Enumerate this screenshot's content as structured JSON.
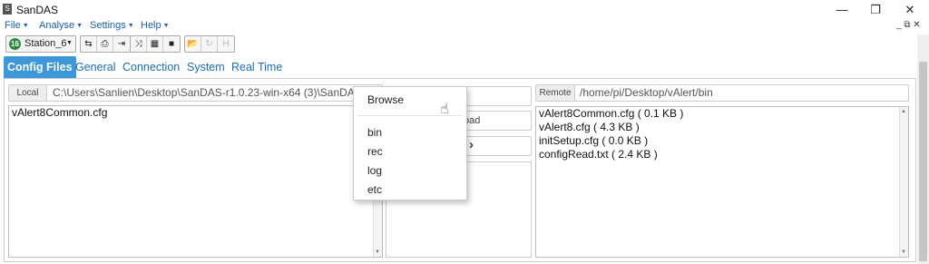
{
  "window": {
    "app_icon": "S",
    "title": "SanDAS",
    "minimize": "—",
    "restore": "❐",
    "close": "✕"
  },
  "menu": {
    "items": [
      "File",
      "Analyse",
      "Settings",
      "Help"
    ],
    "mdi_controls": "_ ⧉ ✕"
  },
  "toolbar": {
    "station_badge": "16",
    "station_label": "Station_6",
    "group1": [
      "⇆",
      "⎙",
      "⇥"
    ],
    "group2": [
      "⤨",
      "▦",
      "■"
    ],
    "group3": [
      "📂",
      "↻",
      "H"
    ]
  },
  "tabs": [
    "Config Files",
    "General",
    "Connection",
    "System",
    "Real Time"
  ],
  "local": {
    "tag": "Local",
    "path": "C:\\Users\\Sanlien\\Desktop\\SanDAS-r1.0.23-win-x64 (3)\\SanDASD",
    "files": [
      "vAlert8Common.cfg"
    ]
  },
  "middle": {
    "upload_partial": "oad",
    "arrow": "›"
  },
  "remote": {
    "tag": "Remote",
    "path": "/home/pi/Desktop/vAlert/bin",
    "files": [
      "vAlert8Common.cfg ( 0.1 KB )",
      "vAlert8.cfg ( 4.3 KB )",
      "initSetup.cfg ( 0.0 KB )",
      "configRead.txt ( 2.4 KB )"
    ]
  },
  "dropdown": {
    "items": [
      "Browse",
      "bin",
      "rec",
      "log",
      "etc"
    ]
  },
  "icons": {
    "cursor": "hand-pointer-icon"
  },
  "colors": {
    "menu_text": "#1b5fb3",
    "tab_active_bg": "#3d97d9",
    "station_badge": "#2e8b3e"
  }
}
